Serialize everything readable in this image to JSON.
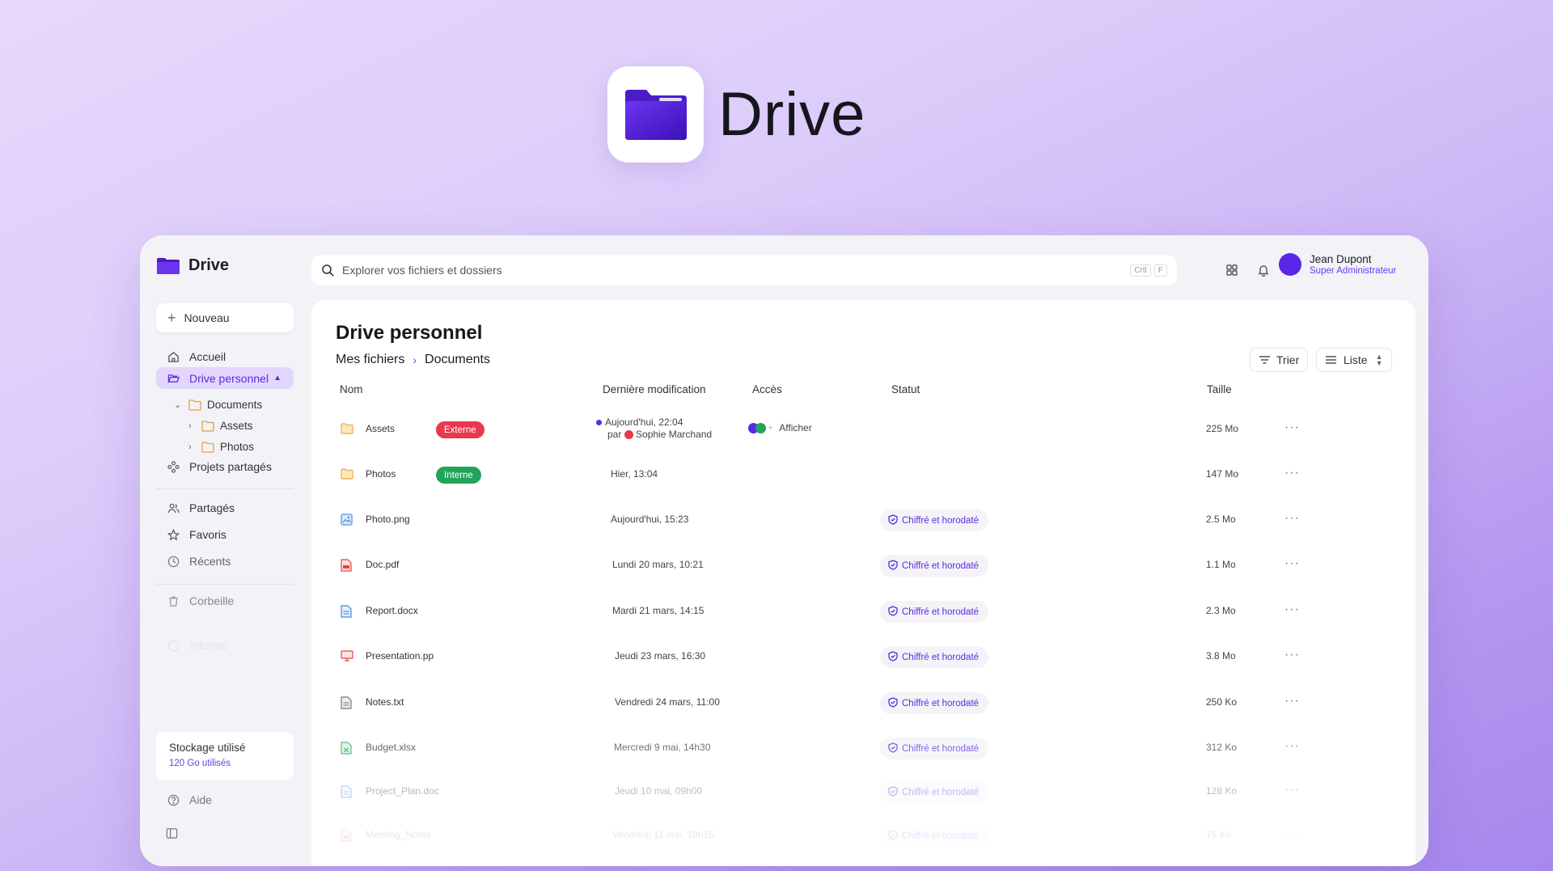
{
  "hero": {
    "title": "Drive"
  },
  "app": {
    "brand": "Drive",
    "search": {
      "placeholder": "Explorer vos fichiers et dossiers",
      "kbd1": "Crtl",
      "kbd2": "F"
    },
    "user": {
      "name": "Jean Dupont",
      "role": "Super Administrateur"
    }
  },
  "sidebar": {
    "new_label": "Nouveau",
    "home": "Accueil",
    "personal": "Drive personnel",
    "tree": {
      "documents": "Documents",
      "assets": "Assets",
      "photos": "Photos"
    },
    "shared_projects": "Projets partagés",
    "shared": "Partagés",
    "favorites": "Favoris",
    "recent": "Récents",
    "trash": "Corbeille",
    "faded": "Informe",
    "storage_title": "Stockage utilisé",
    "storage_value": "120 Go utilisés",
    "help": "Aide"
  },
  "main": {
    "title": "Drive personnel",
    "breadcrumb": [
      "Mes fichiers",
      "Documents"
    ],
    "sort_label": "Trier",
    "view_label": "Liste",
    "columns": {
      "name": "Nom",
      "modified": "Dernière modification",
      "access": "Accès",
      "status": "Statut",
      "size": "Taille"
    }
  },
  "files": [
    {
      "name": "Assets",
      "type": "folder",
      "badge": "Externe",
      "badge_color": "#e8384f",
      "modified": "Aujourd'hui, 22:04",
      "modified_by_prefix": "par",
      "modified_by": "Sophie Marchand",
      "access": "Afficher",
      "status": "",
      "size": "225 Mo"
    },
    {
      "name": "Photos",
      "type": "folder",
      "badge": "Interne",
      "badge_color": "#22a35a",
      "modified": "Hier, 13:04",
      "status": "",
      "size": "147 Mo"
    },
    {
      "name": "Photo.png",
      "type": "image",
      "modified": "Aujourd'hui, 15:23",
      "status": "Chiffré et horodaté",
      "size": "2.5 Mo"
    },
    {
      "name": "Doc.pdf",
      "type": "pdf",
      "modified": "Lundi 20 mars, 10:21",
      "status": "Chiffré et horodaté",
      "size": "1.1 Mo"
    },
    {
      "name": "Report.docx",
      "type": "doc",
      "modified": "Mardi 21 mars, 14:15",
      "status": "Chiffré et horodaté",
      "size": "2.3 Mo"
    },
    {
      "name": "Presentation.pp",
      "type": "ppt",
      "modified": "Jeudi 23 mars, 16:30",
      "status": "Chiffré et horodaté",
      "size": "3.8 Mo"
    },
    {
      "name": "Notes.txt",
      "type": "txt",
      "modified": "Vendredi 24 mars, 11:00",
      "status": "Chiffré et horodaté",
      "size": "250 Ko"
    },
    {
      "name": "Budget.xlsx",
      "type": "xls",
      "modified": "Mercredi 9 mai, 14h30",
      "status": "Chiffré et horodaté",
      "size": "312 Ko"
    },
    {
      "name": "Project_Plan.doc",
      "type": "doc",
      "modified": "Jeudi 10 mai, 09h00",
      "status": "Chiffré et horodaté",
      "size": "128 Ko"
    },
    {
      "name": "Meeting_Notes",
      "type": "pdf",
      "modified": "Vendredi 11 mai, 10h15",
      "status": "Chiffré et horodaté",
      "size": "75 Ko"
    }
  ],
  "colors": {
    "accent": "#5b2be0",
    "accent_light": "#e3d6fc",
    "folder": "#f6c56b"
  }
}
